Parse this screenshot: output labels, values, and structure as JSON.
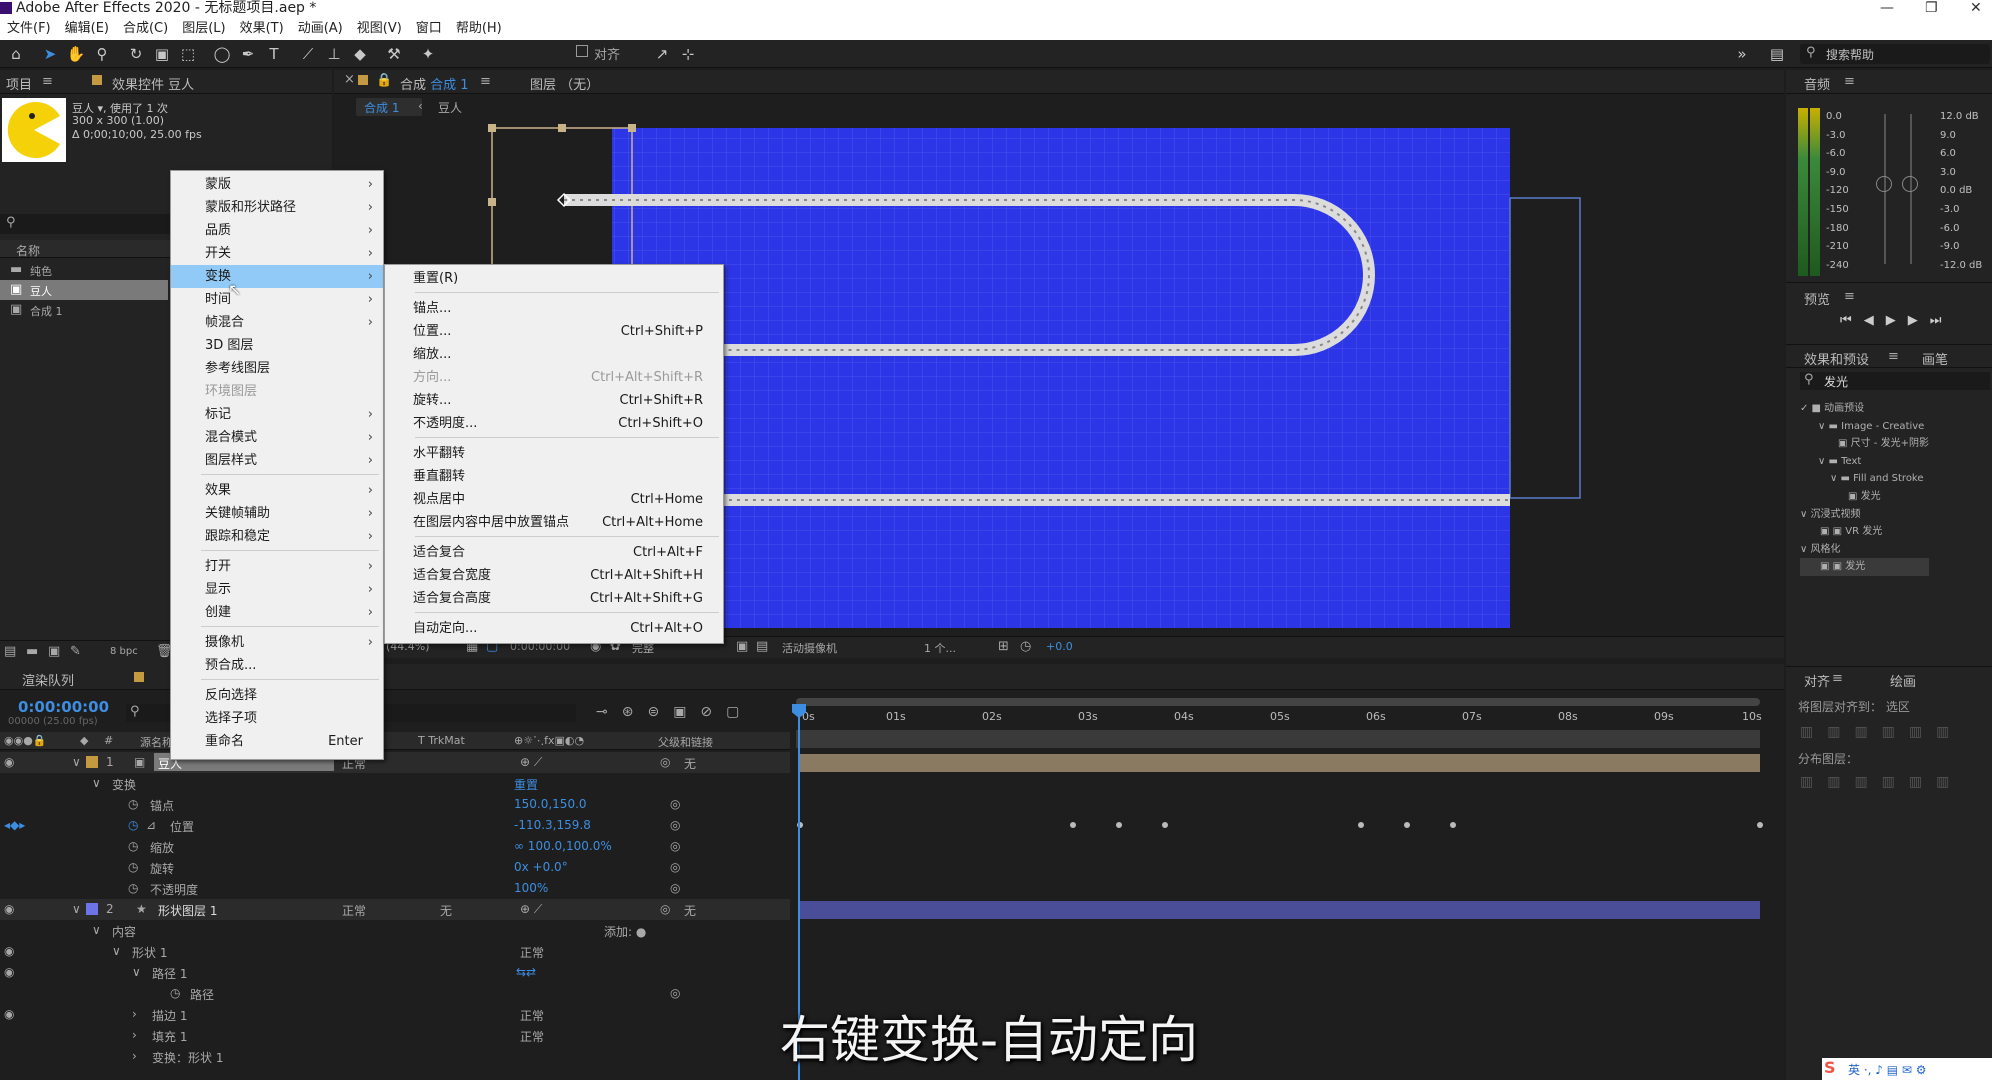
{
  "window": {
    "title": "Adobe After Effects 2020 - 无标题项目.aep *",
    "min": "—",
    "max": "❐",
    "close": "✕"
  },
  "menubar": [
    "文件(F)",
    "编辑(E)",
    "合成(C)",
    "图层(L)",
    "效果(T)",
    "动画(A)",
    "视图(V)",
    "窗口",
    "帮助(H)"
  ],
  "toolbar": {
    "snap_label": "对齐",
    "search_placeholder": "搜索帮助"
  },
  "project": {
    "tab_project": "项目",
    "tab_effects": "效果控件 豆人",
    "item_name": "豆人 ▾",
    "used": ", 使用了 1 次",
    "size": "300 x 300 (1.00)",
    "duration": "Δ 0;00;10;00, 25.00 fps",
    "col_name": "名称",
    "items": [
      "纯色",
      "豆人",
      "合成 1"
    ]
  },
  "context_menu": {
    "items": [
      "蒙版",
      "蒙版和形状路径",
      "品质",
      "开关",
      "变换",
      "时间",
      "帧混合",
      "3D 图层",
      "参考线图层",
      "环境图层",
      "标记",
      "混合模式",
      "图层样式",
      "效果",
      "关键帧辅助",
      "跟踪和稳定",
      "打开",
      "显示",
      "创建",
      "摄像机",
      "预合成...",
      "反向选择",
      "选择子项",
      "重命名"
    ],
    "rename_shortcut": "Enter"
  },
  "submenu": {
    "items": [
      {
        "label": "重置(R)",
        "sc": ""
      },
      {
        "label": "锚点...",
        "sc": ""
      },
      {
        "label": "位置...",
        "sc": "Ctrl+Shift+P"
      },
      {
        "label": "缩放...",
        "sc": ""
      },
      {
        "label": "方向...",
        "sc": "Ctrl+Alt+Shift+R"
      },
      {
        "label": "旋转...",
        "sc": "Ctrl+Shift+R"
      },
      {
        "label": "不透明度...",
        "sc": "Ctrl+Shift+O"
      },
      {
        "label": "水平翻转",
        "sc": ""
      },
      {
        "label": "垂直翻转",
        "sc": ""
      },
      {
        "label": "视点居中",
        "sc": "Ctrl+Home"
      },
      {
        "label": "在图层内容中居中放置锚点",
        "sc": "Ctrl+Alt+Home"
      },
      {
        "label": "适合复合",
        "sc": "Ctrl+Alt+F"
      },
      {
        "label": "适合复合宽度",
        "sc": "Ctrl+Alt+Shift+H"
      },
      {
        "label": "适合复合高度",
        "sc": "Ctrl+Alt+Shift+G"
      },
      {
        "label": "自动定向...",
        "sc": "Ctrl+Alt+O"
      }
    ]
  },
  "comp": {
    "tab_comp": "合成",
    "tab_comp_name": "合成 1",
    "tab_layer": "图层 （无）",
    "bc1": "合成 1",
    "bc2": "豆人",
    "zoom": "(44.4%)",
    "time": "0:00:00:00",
    "quality": "完整",
    "camera": "活动摄像机",
    "views": "1 个...",
    "exposure": "+0.0",
    "bpc": "8 bpc"
  },
  "audio": {
    "tab": "音频",
    "left": [
      "0.0",
      "-3.0",
      "-6.0",
      "-9.0",
      "-120",
      "-150",
      "-180",
      "-210",
      "-240"
    ],
    "right": [
      "12.0 dB",
      "9.0",
      "6.0",
      "3.0",
      "0.0 dB",
      "-3.0",
      "-6.0",
      "-9.0",
      "-12.0 dB"
    ]
  },
  "preview": {
    "tab": "预览"
  },
  "effects": {
    "tab": "效果和预设",
    "tab2": "画笔",
    "search": "发光",
    "tree": [
      "✓ ■ 动画预设",
      "∨ ▬ Image - Creative",
      "▣ 尺寸 - 发光+阴影",
      "∨ ▬ Text",
      "∨ ▬ Fill and Stroke",
      "▣ 发光",
      "∨ 沉浸式视频",
      "▣ ▣ VR 发光",
      "∨ 风格化",
      "▣ ▣ 发光"
    ]
  },
  "align": {
    "tab": "对齐",
    "tab2": "绘画",
    "align_to": "将图层对齐到：",
    "sel": "选区",
    "dist": "分布图层："
  },
  "timeline": {
    "tab_render": "渲染队列",
    "timecode": "0:00:00:00",
    "fps": "00000 (25.00 fps)",
    "col_src": "源名称",
    "col_mode": "模式",
    "col_trk": "T  TrkMat",
    "col_parent": "父级和链接",
    "ruler": [
      "0s",
      "01s",
      "02s",
      "03s",
      "04s",
      "05s",
      "06s",
      "07s",
      "08s",
      "09s",
      "10s"
    ],
    "rows": [
      {
        "num": "1",
        "name": "豆人",
        "mode": "正常",
        "parent": "无"
      },
      {
        "label": "变换",
        "val": "重置"
      },
      {
        "label": "锚点",
        "val": "150.0,150.0"
      },
      {
        "label": "位置",
        "val": "-110.3,159.8"
      },
      {
        "label": "缩放",
        "val": "∞ 100.0,100.0%"
      },
      {
        "label": "旋转",
        "val": "0x +0.0°"
      },
      {
        "label": "不透明度",
        "val": "100%"
      },
      {
        "num": "2",
        "name": "形状图层 1",
        "mode": "正常",
        "trk": "无",
        "parent": "无"
      },
      {
        "label": "内容",
        "val": "添加: ●"
      },
      {
        "label": "形状 1",
        "val": "正常"
      },
      {
        "label": "路径 1",
        "val": ""
      },
      {
        "label": "路径",
        "val": ""
      },
      {
        "label": "描边 1",
        "val": "正常"
      },
      {
        "label": "填充 1",
        "val": "正常"
      },
      {
        "label": "变换：形状 1",
        "val": ""
      }
    ]
  },
  "subtitle": "右键变换-自动定向",
  "colors": {
    "comp_bg": "#2d36e6",
    "highlight": "#91c9f7",
    "accent": "#3d8ee0"
  }
}
